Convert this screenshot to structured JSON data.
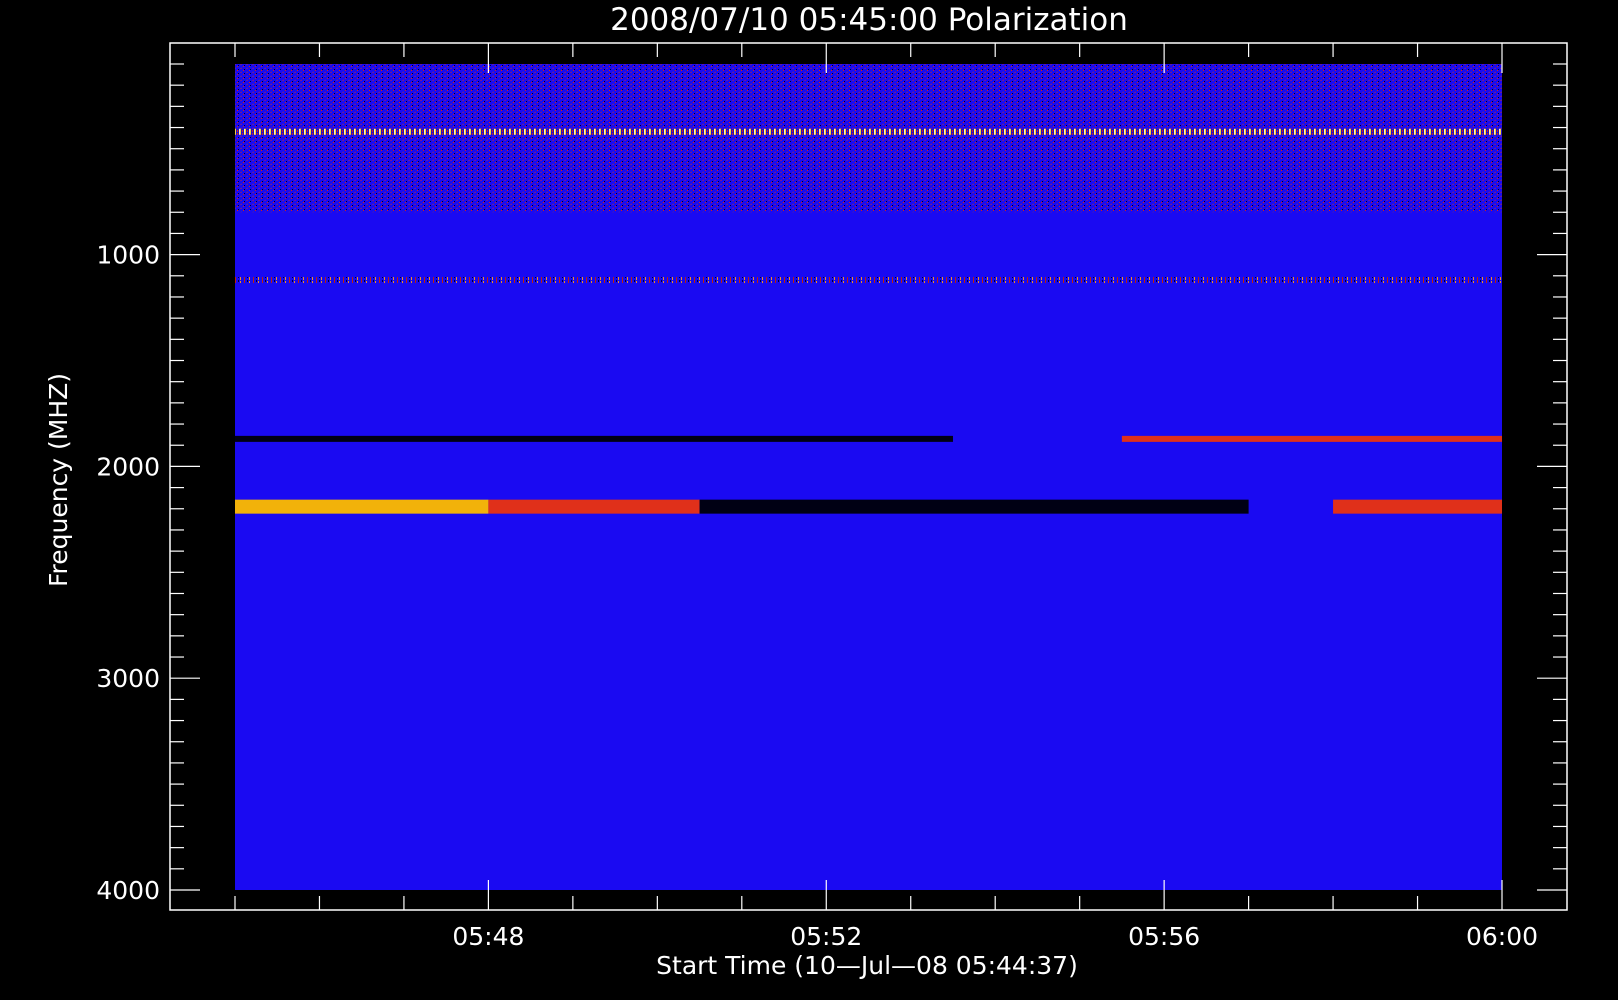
{
  "chart_data": {
    "type": "heatmap",
    "title": "2008/07/10 05:45:00 Polarization",
    "xlabel": "Start Time (10—Jul—08 05:44:37)",
    "ylabel": "Frequency (MHZ)",
    "x_ticks": [
      "05:48",
      "05:52",
      "05:56",
      "06:00"
    ],
    "y_ticks": [
      1000,
      2000,
      3000,
      4000
    ],
    "y_range_mhz": [
      100,
      4000
    ],
    "y_axis_inverted": true,
    "x_range": [
      "05:45:00",
      "06:00:00"
    ],
    "colors": {
      "background": "#000000",
      "base_field": "#1a0af2",
      "hot": "#f2b20a",
      "warm": "#e0301a",
      "cold": "#000014"
    },
    "features": [
      {
        "name": "rfi-band-high-noise",
        "freq_mhz_from": 100,
        "freq_mhz_to": 800,
        "time_from": "05:45:00",
        "time_to": "06:00:00",
        "state": "noisy-mixed"
      },
      {
        "name": "rfi-band-400",
        "freq_mhz": 420,
        "time_from": "05:45:00",
        "time_to": "06:00:00",
        "state": "bright-speckled"
      },
      {
        "name": "rfi-band-1120",
        "freq_mhz": 1120,
        "time_from": "05:45:00",
        "time_to": "06:00:00",
        "state": "sparse-red"
      },
      {
        "name": "line-1870-dark",
        "freq_mhz": 1870,
        "time_from": "05:45:00",
        "time_to": "05:53:30",
        "state": "dark"
      },
      {
        "name": "line-1870-red",
        "freq_mhz": 1870,
        "time_from": "05:55:30",
        "time_to": "06:00:00",
        "state": "red-bright"
      },
      {
        "name": "band-2190-yellow",
        "freq_mhz": 2190,
        "time_from": "05:45:00",
        "time_to": "05:48:00",
        "state": "yellow"
      },
      {
        "name": "band-2190-red",
        "freq_mhz": 2190,
        "time_from": "05:48:00",
        "time_to": "05:50:30",
        "state": "red"
      },
      {
        "name": "band-2190-dark",
        "freq_mhz": 2190,
        "time_from": "05:50:30",
        "time_to": "05:57:00",
        "state": "dark"
      },
      {
        "name": "band-2190-red-late",
        "freq_mhz": 2190,
        "time_from": "05:58:00",
        "time_to": "06:00:00",
        "state": "red"
      }
    ]
  }
}
